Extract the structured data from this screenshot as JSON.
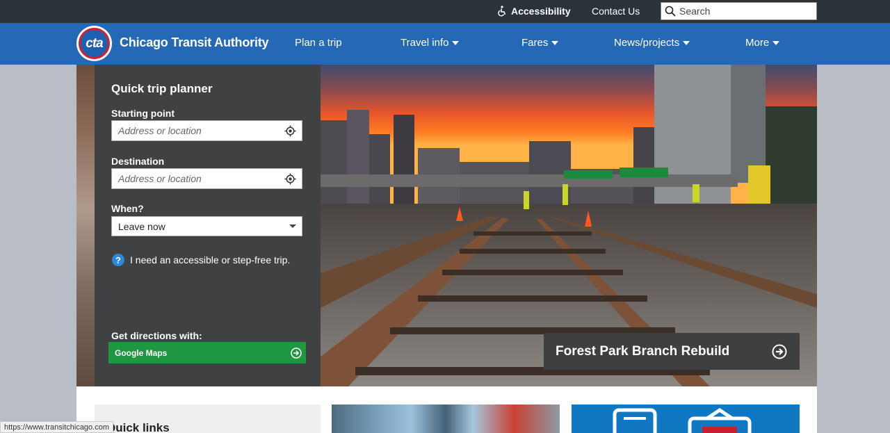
{
  "topbar": {
    "accessibility_label": "Accessibility",
    "contact_label": "Contact Us",
    "search_placeholder": "Search"
  },
  "nav": {
    "logo_text": "cta",
    "brand": "Chicago Transit Authority",
    "items": [
      {
        "label": "Plan a trip",
        "dropdown": false
      },
      {
        "label": "Travel info",
        "dropdown": true
      },
      {
        "label": "Fares",
        "dropdown": true
      },
      {
        "label": "News/projects",
        "dropdown": true
      },
      {
        "label": "More",
        "dropdown": true
      }
    ]
  },
  "planner": {
    "title": "Quick trip planner",
    "start_label": "Starting point",
    "start_placeholder": "Address or location",
    "dest_label": "Destination",
    "dest_placeholder": "Address or location",
    "when_label": "When?",
    "when_value": "Leave now",
    "accessible_text": "I need an accessible or step-free trip.",
    "directions_label": "Get directions with:",
    "directions_provider": "Google Maps"
  },
  "hero": {
    "caption": "Forest Park Branch Rebuild"
  },
  "cards": {
    "quicklinks_title": "Quick links"
  },
  "status_url": "https://www.transitchicago.com",
  "colors": {
    "topbar": "#2b3238",
    "nav": "#2568b5",
    "planner": "#3f4143",
    "google_maps_button": "#1e9740",
    "logo_ring": "#d0222e"
  }
}
